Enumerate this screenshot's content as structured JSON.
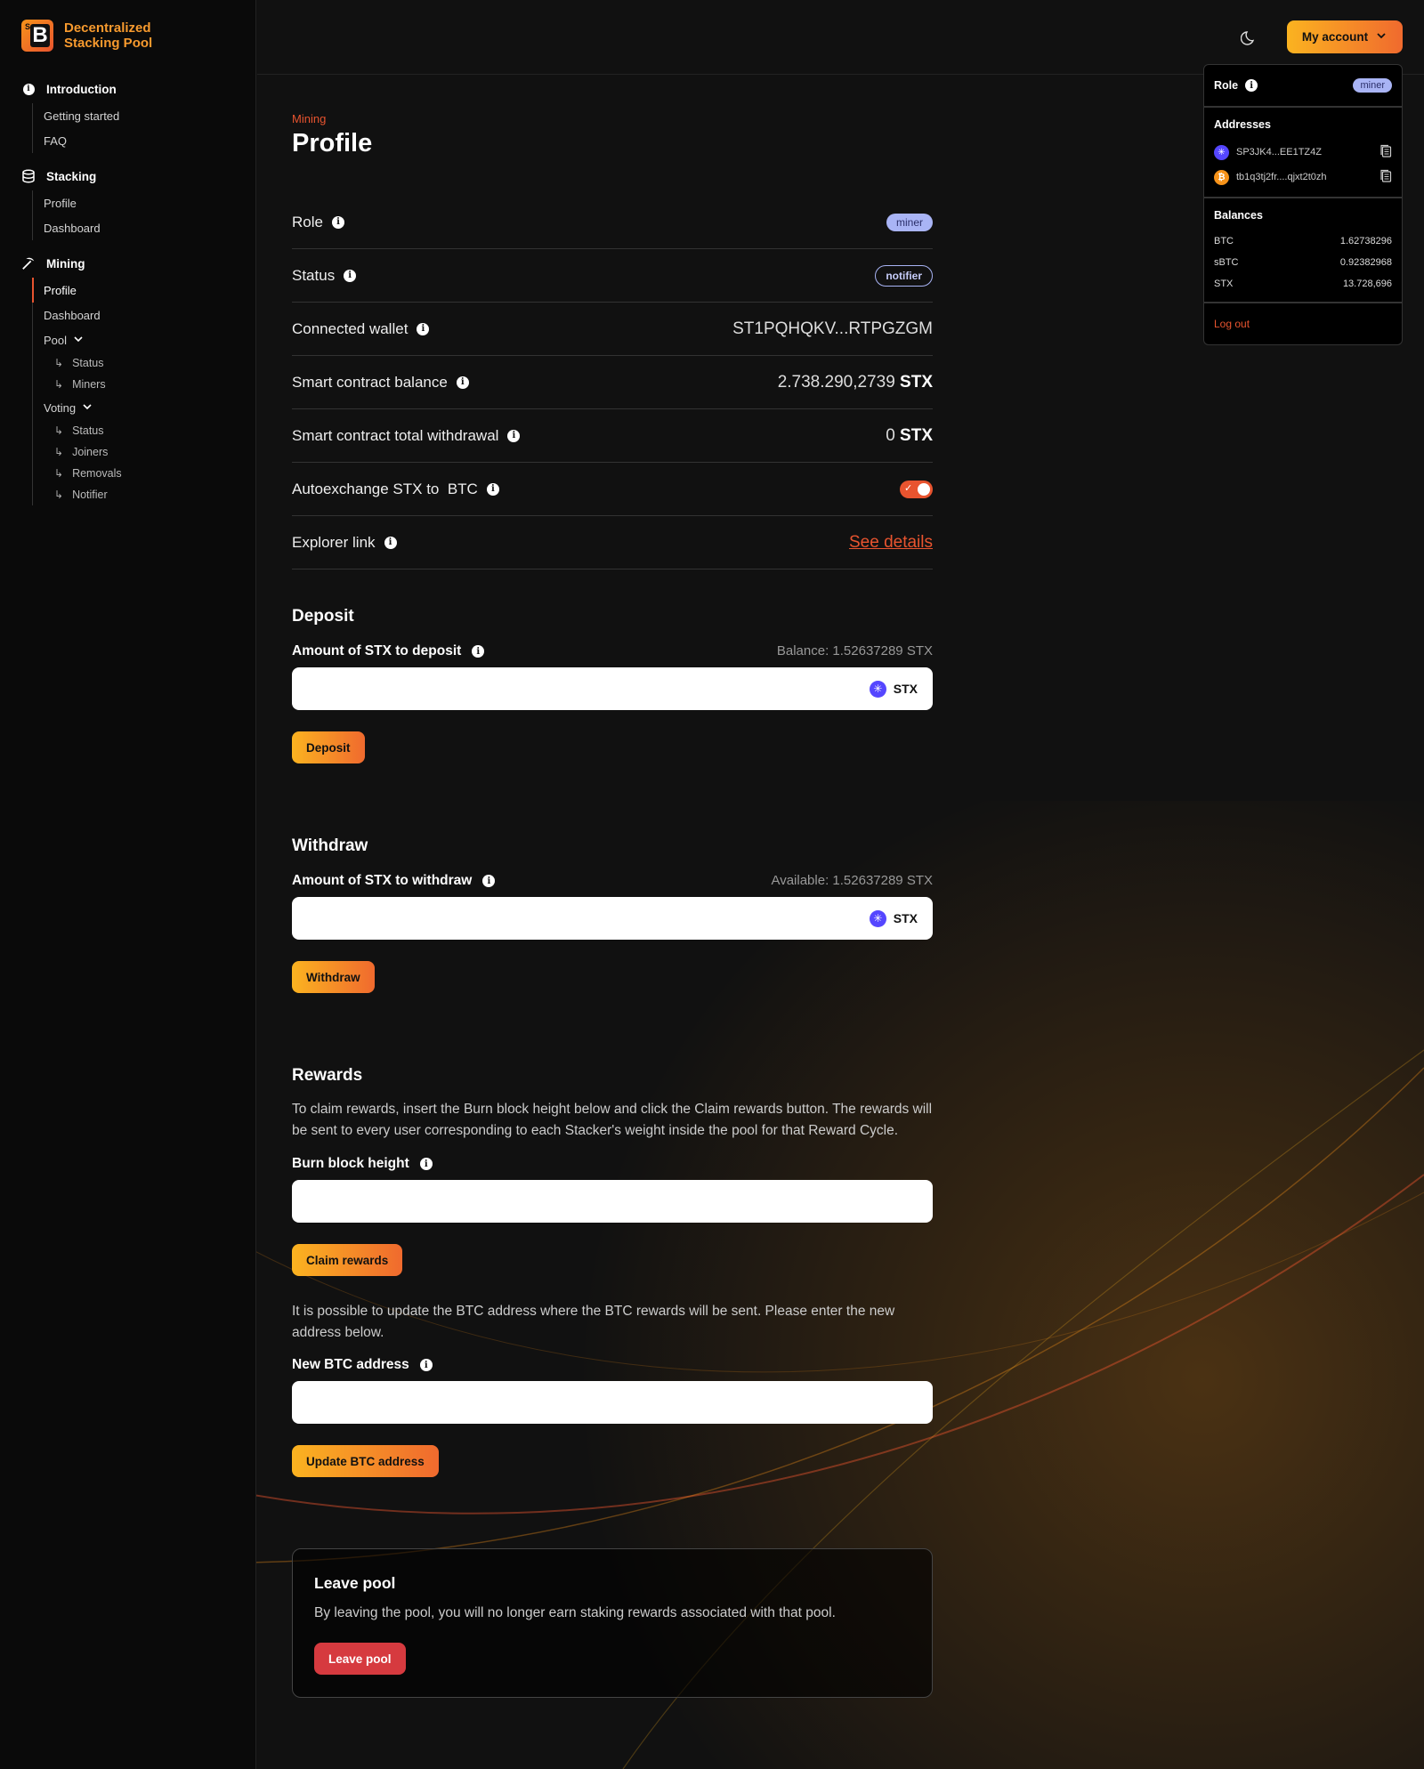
{
  "brand": {
    "line1": "Decentralized",
    "line2": "Stacking Pool"
  },
  "sidebar": {
    "introduction": {
      "title": "Introduction",
      "items": [
        "Getting started",
        "FAQ"
      ]
    },
    "stacking": {
      "title": "Stacking",
      "items": [
        "Profile",
        "Dashboard"
      ]
    },
    "mining": {
      "title": "Mining",
      "items": [
        "Profile",
        "Dashboard"
      ],
      "pool": {
        "label": "Pool",
        "items": [
          "Status",
          "Miners"
        ]
      },
      "voting": {
        "label": "Voting",
        "items": [
          "Status",
          "Joiners",
          "Removals",
          "Notifier"
        ]
      }
    }
  },
  "topbar": {
    "account_label": "My account"
  },
  "dropdown": {
    "role_label": "Role",
    "role_value": "miner",
    "addresses_title": "Addresses",
    "stx_address": "SP3JK4...EE1TZ4Z",
    "btc_address": "tb1q3tj2fr....qjxt2t0zh",
    "balances_title": "Balances",
    "balances": [
      {
        "name": "BTC",
        "value": "1.62738296"
      },
      {
        "name": "sBTC",
        "value": "0.92382968"
      },
      {
        "name": "STX",
        "value": "13.728,696"
      }
    ],
    "logout": "Log out"
  },
  "page": {
    "eyebrow": "Mining",
    "title": "Profile"
  },
  "profile": {
    "role_label": "Role",
    "role_value": "miner",
    "status_label": "Status",
    "status_value": "notifier",
    "wallet_label": "Connected wallet",
    "wallet_value": "ST1PQHQKV...RTPGZGM",
    "balance_label": "Smart contract balance",
    "balance_value": "2.738.290,2739",
    "balance_unit": "STX",
    "withdrawal_label": "Smart contract total withdrawal",
    "withdrawal_value": "0",
    "withdrawal_unit": "STX",
    "autoexchange_label": "Autoexchange STX to  BTC",
    "autoexchange_on": true,
    "explorer_label": "Explorer link",
    "explorer_value": "See details"
  },
  "deposit": {
    "title": "Deposit",
    "label": "Amount of STX to deposit",
    "aux": "Balance: 1.52637289 STX",
    "unit": "STX",
    "button": "Deposit"
  },
  "withdraw": {
    "title": "Withdraw",
    "label": "Amount of STX to withdraw",
    "aux": "Available: 1.52637289 STX",
    "unit": "STX",
    "button": "Withdraw"
  },
  "rewards": {
    "title": "Rewards",
    "desc": "To claim rewards, insert the Burn block height below and click the Claim rewards button. The rewards will be sent to every user corresponding to each Stacker's weight inside the pool for that Reward Cycle.",
    "burn_label": "Burn block height",
    "claim_button": "Claim rewards",
    "update_desc": "It is possible to update the BTC address where the BTC rewards will be sent. Please enter the new address below.",
    "btc_label": "New BTC address",
    "update_button": "Update BTC address"
  },
  "leave": {
    "title": "Leave pool",
    "desc": "By leaving the pool, you will no longer earn staking rewards associated with that pool.",
    "button": "Leave pool"
  },
  "colors": {
    "accent": "#e8542f",
    "gold": "#fbb320",
    "badge": "#a9b4f5",
    "danger": "#d63a3f"
  }
}
